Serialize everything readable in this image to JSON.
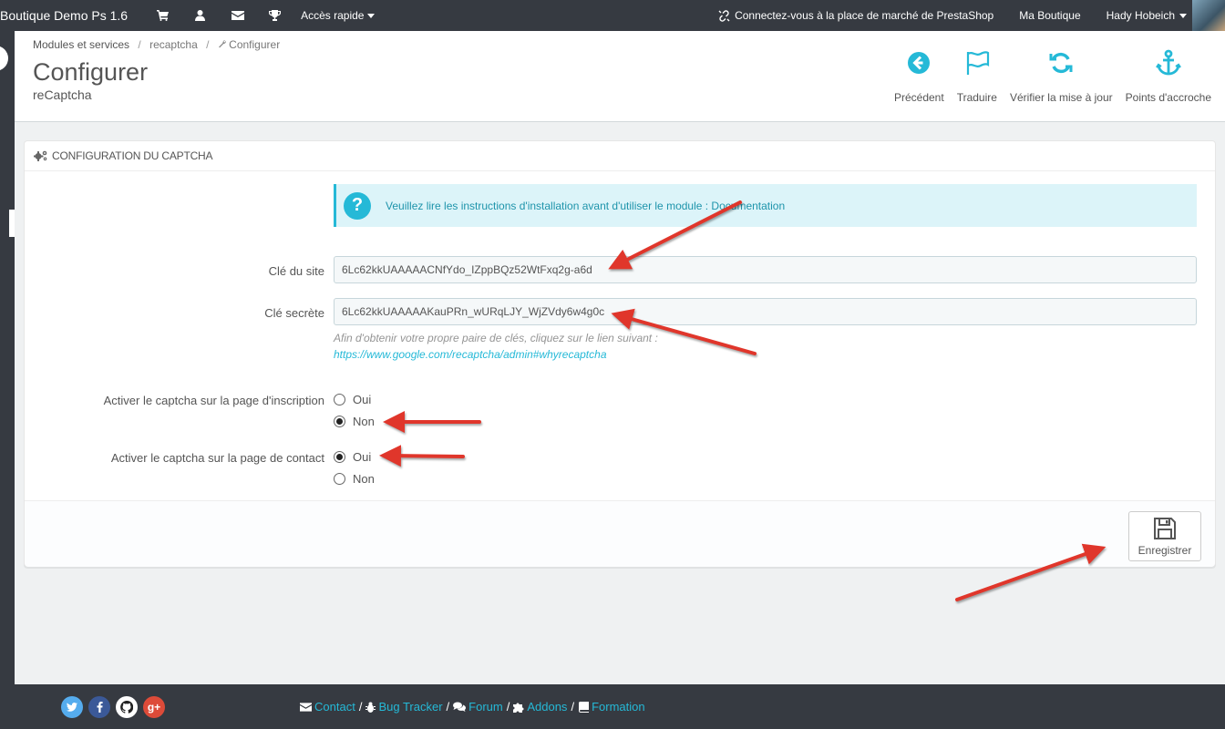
{
  "topbar": {
    "brand": "Boutique Demo Ps 1.6",
    "icons": [
      "cart-icon",
      "user-icon",
      "envelope-icon",
      "trophy-icon"
    ],
    "quick_access": "Accès rapide",
    "marketplace": "Connectez-vous à la place de marché de PrestaShop",
    "my_shop": "Ma Boutique",
    "user_name": "Hady Hobeich"
  },
  "breadcrumb": {
    "items": [
      "Modules et services",
      "recaptcha",
      "Configurer"
    ],
    "separator": "/"
  },
  "header": {
    "title": "Configurer",
    "subtitle": "reCaptcha",
    "toolbar": [
      {
        "label": "Précédent",
        "icon": "arrow-left-circle-icon"
      },
      {
        "label": "Traduire",
        "icon": "flag-icon"
      },
      {
        "label": "Vérifier la mise à jour",
        "icon": "refresh-icon"
      },
      {
        "label": "Points d'accroche",
        "icon": "anchor-icon"
      }
    ]
  },
  "panel": {
    "heading": "Configuration du captcha",
    "alert": "Veuillez lire les instructions d'installation avant d'utiliser le module : Documentation",
    "site_key_label": "Clé du site",
    "site_key_value": "6Lc62kkUAAAAACNfYdo_IZppBQz52WtFxq2g-a6d",
    "secret_key_label": "Clé secrète",
    "secret_key_value": "6Lc62kkUAAAAAKauPRn_wURqLJY_WjZVdy6w4g0c",
    "help_text": "Afin d'obtenir votre propre paire de clés, cliquez sur le lien suivant :",
    "help_link": "https://www.google.com/recaptcha/admin#whyrecaptcha",
    "signup_label": "Activer le captcha sur la page d'inscription",
    "contact_label": "Activer le captcha sur la page de contact",
    "yes": "Oui",
    "no": "Non",
    "signup_selected": "no",
    "contact_selected": "yes",
    "save_label": "Enregistrer"
  },
  "footer": {
    "socials": [
      "twitter-icon",
      "facebook-icon",
      "github-icon",
      "google-plus-icon"
    ],
    "links": [
      "Contact",
      "Bug Tracker",
      "Forum",
      "Addons",
      "Formation"
    ],
    "separator": "/"
  },
  "colors": {
    "topbar": "#363a41",
    "accent": "#25b9d7",
    "annotation_arrow": "#e0362b"
  }
}
